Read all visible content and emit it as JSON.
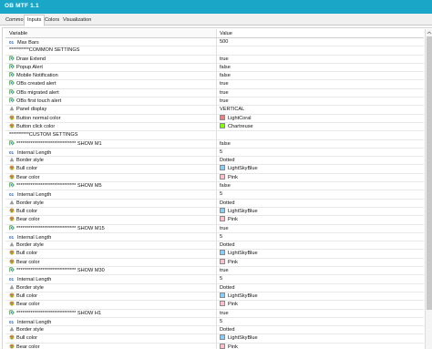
{
  "window": {
    "title": "OB MTF 1.1"
  },
  "tabs": [
    {
      "label": "Common"
    },
    {
      "label": "Inputs"
    },
    {
      "label": "Colors"
    },
    {
      "label": "Visualization"
    }
  ],
  "table": {
    "headers": {
      "variable": "Variable",
      "value": "Value"
    },
    "rows": [
      {
        "icon": "number-icon",
        "variable": "Max Bars",
        "value": "500"
      },
      {
        "icon": "none",
        "variable": "**********COMMON SETTINGS",
        "value": ""
      },
      {
        "icon": "boolean-icon",
        "variable": "Draw Extend",
        "value": "true"
      },
      {
        "icon": "boolean-icon",
        "variable": "Popup Alert",
        "value": "false"
      },
      {
        "icon": "boolean-icon",
        "variable": "Mobile Notification",
        "value": "false"
      },
      {
        "icon": "boolean-icon",
        "variable": "OBs created alert",
        "value": "true"
      },
      {
        "icon": "boolean-icon",
        "variable": "OBs migrated alert",
        "value": "true"
      },
      {
        "icon": "boolean-icon",
        "variable": "OBs first touch alert",
        "value": "true"
      },
      {
        "icon": "enum-icon",
        "variable": "Panel display",
        "value": "VERTICAL"
      },
      {
        "icon": "color-icon",
        "variable": "Button normal color",
        "value": "LightCoral",
        "swatch": "#f08080"
      },
      {
        "icon": "color-icon",
        "variable": "Button click color",
        "value": "Chartreuse",
        "swatch": "#7fff00"
      },
      {
        "icon": "none",
        "variable": "**********CUSTOM SETTINGS",
        "value": ""
      },
      {
        "icon": "boolean-icon",
        "variable": "****************************** SHOW M1",
        "value": "false"
      },
      {
        "icon": "number-icon",
        "variable": "Internal Length",
        "value": "5"
      },
      {
        "icon": "enum-icon",
        "variable": "Border style",
        "value": "Dotted"
      },
      {
        "icon": "color-icon",
        "variable": "Bull color",
        "value": "LightSkyBlue",
        "swatch": "#87cefa"
      },
      {
        "icon": "color-icon",
        "variable": "Bear color",
        "value": "Pink",
        "swatch": "#ffc0cb"
      },
      {
        "icon": "boolean-icon",
        "variable": "****************************** SHOW M5",
        "value": "false"
      },
      {
        "icon": "number-icon",
        "variable": "Internal Length",
        "value": "5"
      },
      {
        "icon": "enum-icon",
        "variable": "Border style",
        "value": "Dotted"
      },
      {
        "icon": "color-icon",
        "variable": "Bull color",
        "value": "LightSkyBlue",
        "swatch": "#87cefa"
      },
      {
        "icon": "color-icon",
        "variable": "Bear color",
        "value": "Pink",
        "swatch": "#ffc0cb"
      },
      {
        "icon": "boolean-icon",
        "variable": "****************************** SHOW M15",
        "value": "true"
      },
      {
        "icon": "number-icon",
        "variable": "Internal Length",
        "value": "5"
      },
      {
        "icon": "enum-icon",
        "variable": "Border style",
        "value": "Dotted"
      },
      {
        "icon": "color-icon",
        "variable": "Bull color",
        "value": "LightSkyBlue",
        "swatch": "#87cefa"
      },
      {
        "icon": "color-icon",
        "variable": "Bear color",
        "value": "Pink",
        "swatch": "#ffc0cb"
      },
      {
        "icon": "boolean-icon",
        "variable": "****************************** SHOW M30",
        "value": "true"
      },
      {
        "icon": "number-icon",
        "variable": "Internal Length",
        "value": "5"
      },
      {
        "icon": "enum-icon",
        "variable": "Border style",
        "value": "Dotted"
      },
      {
        "icon": "color-icon",
        "variable": "Bull color",
        "value": "LightSkyBlue",
        "swatch": "#87cefa"
      },
      {
        "icon": "color-icon",
        "variable": "Bear color",
        "value": "Pink",
        "swatch": "#ffc0cb"
      },
      {
        "icon": "boolean-icon",
        "variable": "****************************** SHOW H1",
        "value": "true"
      },
      {
        "icon": "number-icon",
        "variable": "Internal Length",
        "value": "5"
      },
      {
        "icon": "enum-icon",
        "variable": "Border style",
        "value": "Dotted"
      },
      {
        "icon": "color-icon",
        "variable": "Bull color",
        "value": "LightSkyBlue",
        "swatch": "#87cefa"
      },
      {
        "icon": "color-icon",
        "variable": "Bear color",
        "value": "Pink",
        "swatch": "#ffc0cb"
      }
    ]
  },
  "colors": {
    "titlebar": "#1aa7c7",
    "accent_blue": "#2a64b8",
    "boolean_green": "#3a9a3a"
  }
}
